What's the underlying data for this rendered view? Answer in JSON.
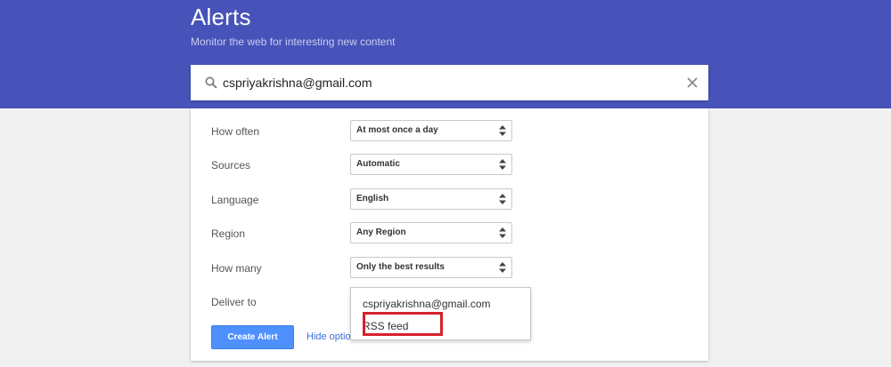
{
  "header": {
    "title": "Alerts",
    "subtitle": "Monitor the web for interesting new content"
  },
  "search": {
    "value": "cspriyakrishna@gmail.com",
    "icon": "search-icon",
    "clear_icon": "close-icon"
  },
  "options": [
    {
      "label": "How often",
      "value": "At most once a day"
    },
    {
      "label": "Sources",
      "value": "Automatic"
    },
    {
      "label": "Language",
      "value": "English"
    },
    {
      "label": "Region",
      "value": "Any Region"
    },
    {
      "label": "How many",
      "value": "Only the best results"
    }
  ],
  "deliver": {
    "label": "Deliver to",
    "options": [
      "cspriyakrishna@gmail.com",
      "RSS feed"
    ]
  },
  "actions": {
    "create_label": "Create Alert",
    "hide_options_label": "Hide optio"
  },
  "colors": {
    "header_bg": "#4753b8",
    "button_bg": "#4d90fe",
    "highlight_border": "#d6202c",
    "link": "#3b6dd8"
  }
}
